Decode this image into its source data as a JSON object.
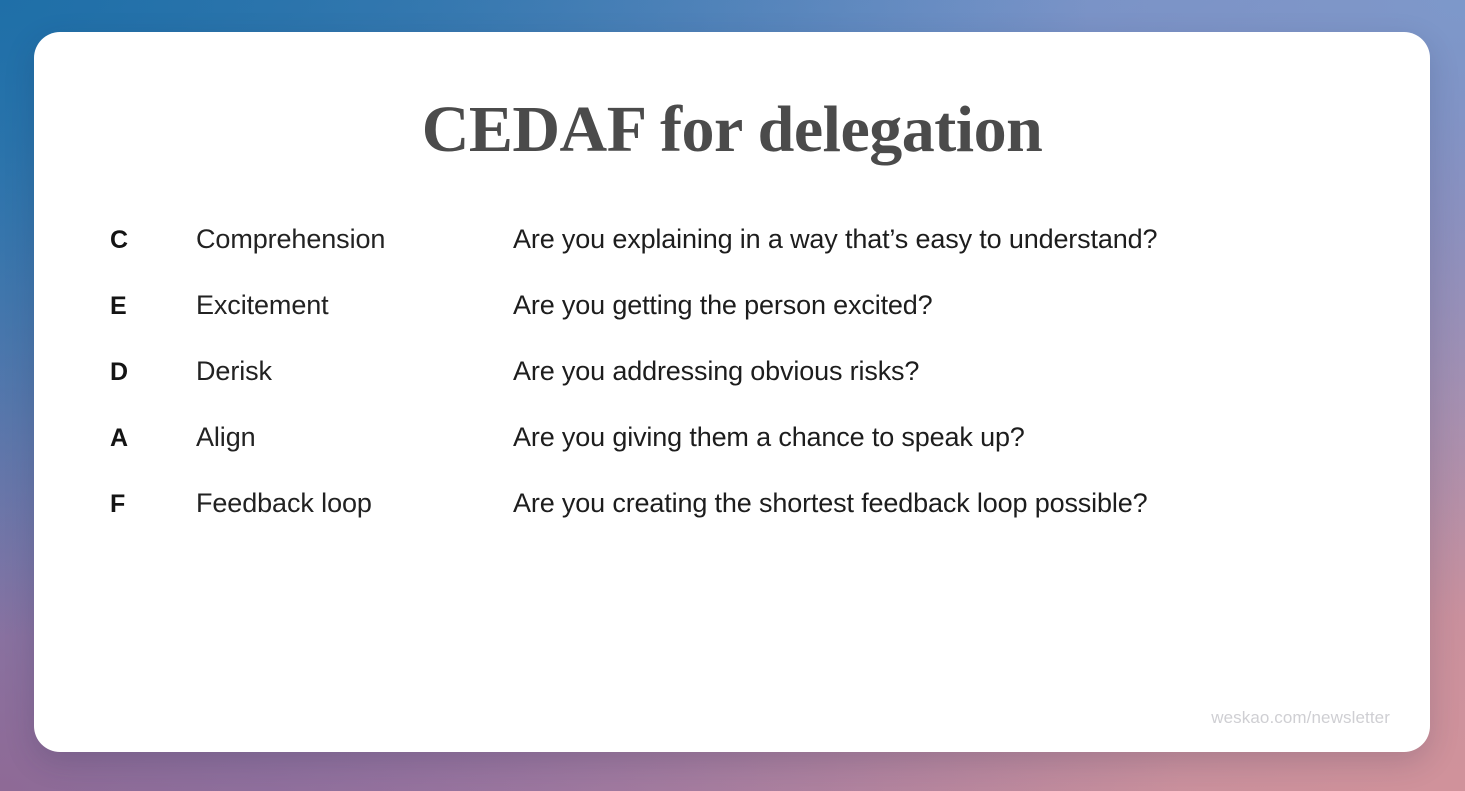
{
  "slide": {
    "title": "CEDAF for delegation",
    "footer": "weskao.com/newsletter",
    "colors": {
      "card_background": "#ffffff",
      "title_text": "#4b4b4b",
      "body_text": "#1d1d1d",
      "footer_text": "#cfcfd3",
      "backdrop_top_left": "#1f6fa8",
      "backdrop_top_right": "#7d98ca",
      "backdrop_bottom_left": "#8e6a96",
      "backdrop_bottom_right": "#d0929b"
    },
    "rows": [
      {
        "letter": "C",
        "label": "Comprehension",
        "description": "Are you explaining in a way that’s easy to understand?"
      },
      {
        "letter": "E",
        "label": "Excitement",
        "description": "Are you getting the person excited?"
      },
      {
        "letter": "D",
        "label": "Derisk",
        "description": "Are you addressing obvious risks?"
      },
      {
        "letter": "A",
        "label": "Align",
        "description": "Are you giving them a chance to speak up?"
      },
      {
        "letter": "F",
        "label": "Feedback loop",
        "description": "Are you creating the shortest feedback loop possible?"
      }
    ]
  }
}
